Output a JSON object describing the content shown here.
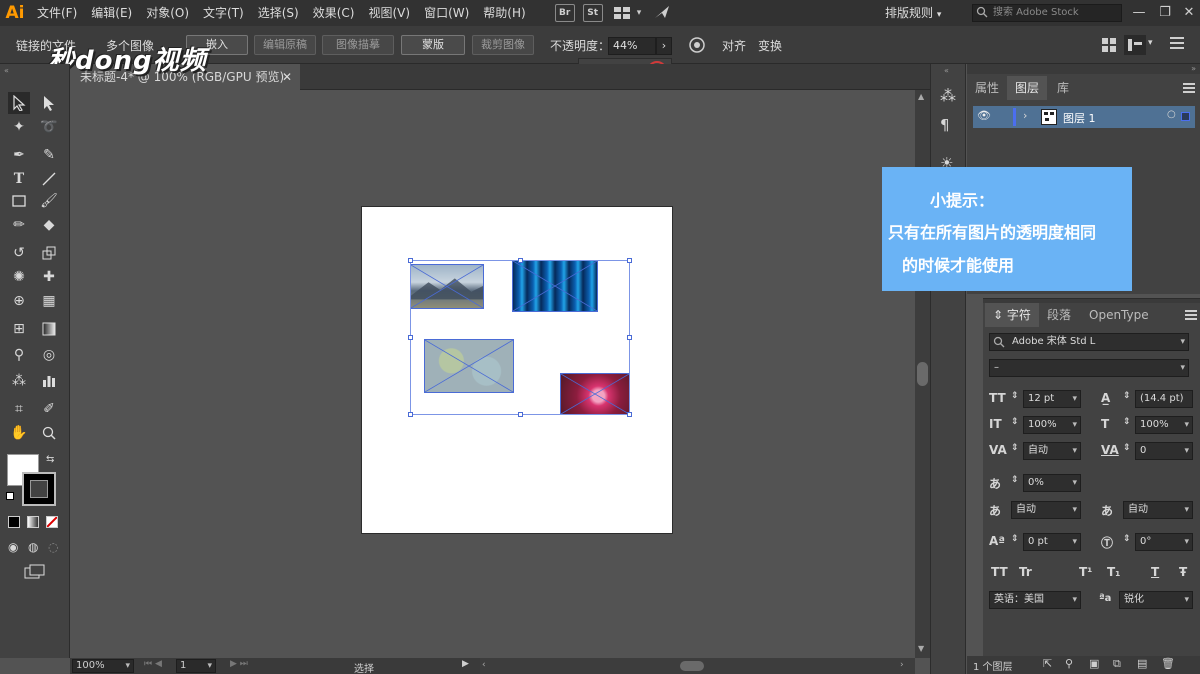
{
  "app": {
    "logo": "Ai",
    "menu": [
      "文件(F)",
      "编辑(E)",
      "对象(O)",
      "文字(T)",
      "选择(S)",
      "效果(C)",
      "视图(V)",
      "窗口(W)",
      "帮助(H)"
    ],
    "bridge_buttons": [
      "Br",
      "St"
    ],
    "workspace": "排版规则",
    "stock_search_placeholder": "搜索 Adobe Stock",
    "window_controls": [
      "—",
      "❐",
      "✕"
    ]
  },
  "controlbar": {
    "linked_file": "链接的文件",
    "multi_image": "多个图像",
    "embed": "嵌入",
    "edit_original": "编辑原稿",
    "image_trace": "图像描摹",
    "mask": "蒙版",
    "crop_image": "裁剪图像",
    "opacity_label": "不透明度：",
    "opacity_value": "44%",
    "opacity_percent": 44,
    "align": "对齐",
    "transform": "变换"
  },
  "watermark": "秒dong视频",
  "document": {
    "tab_title": "未标题-4* @ 100% (RGB/GPU 预览)",
    "close": "✕"
  },
  "status": {
    "zoom": "100%",
    "page": "1",
    "tool": "选择"
  },
  "layers_panel": {
    "tabs": [
      "属性",
      "图层",
      "库"
    ],
    "layer_name": "图层 1",
    "footer": "1 个图层"
  },
  "character_panel": {
    "tabs": [
      "字符",
      "段落",
      "OpenType"
    ],
    "font_family": "Adobe 宋体 Std L",
    "font_style": "–",
    "font_size": "12 pt",
    "leading": "(14.4 pt)",
    "vertical_scale": "100%",
    "horizontal_scale": "100%",
    "kerning": "自动",
    "tracking": "0",
    "baseline_tsume": "0%",
    "aki_left": "自动",
    "aki_right": "自动",
    "baseline_shift": "0 pt",
    "rotation": "0°",
    "language": "英语：美国",
    "anti_alias_label": "ªa",
    "anti_alias": "锐化",
    "style_buttons": [
      "TT",
      "Tr",
      "T¹",
      "T₁",
      "T",
      "Ŧ"
    ]
  },
  "tip": {
    "title": "小提示：",
    "line1": "只有在所有图片的透明度相同",
    "line2": "的时候才能使用"
  },
  "colors": {
    "accent": "#4b98f0",
    "tip_bg": "#6ab3f5",
    "selection": "#4a6bd6",
    "logo": "#ff9a00"
  }
}
